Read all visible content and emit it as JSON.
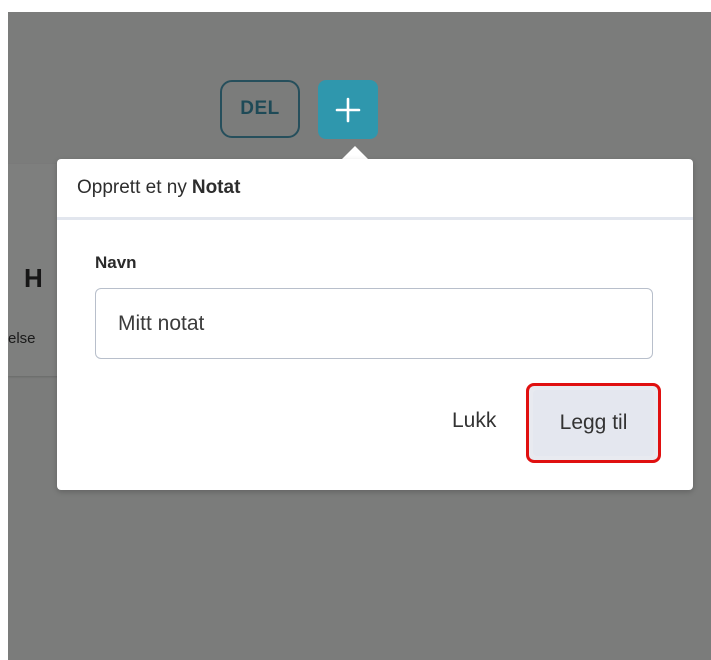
{
  "background": {
    "heading_fragment": "H",
    "sub_fragment": "else"
  },
  "toolbar": {
    "del_label": "DEL",
    "add_icon": "plus-icon"
  },
  "dialog": {
    "title_prefix": "Opprett et ny",
    "title_entity": "Notat",
    "field_label": "Navn",
    "field_value": "Mitt notat",
    "close_label": "Lukk",
    "submit_label": "Legg til"
  },
  "colors": {
    "overlay": "#7b7c7b",
    "add_button": "#2f97ad",
    "highlight": "#e01010"
  }
}
